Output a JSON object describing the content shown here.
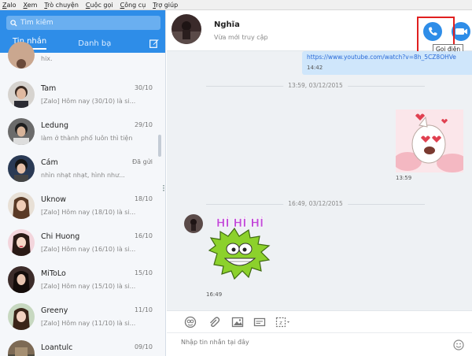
{
  "menu": [
    "Zalo",
    "Xem",
    "Trò chuyện",
    "Cuộc gọi",
    "Công cụ",
    "Trợ giúp"
  ],
  "menu_underline": [
    "Z",
    "X",
    "T",
    "C",
    "C",
    "T"
  ],
  "search": {
    "placeholder": "Tìm kiếm"
  },
  "tabs": {
    "messages": "Tin nhắn",
    "contacts": "Danh bạ"
  },
  "contacts": [
    {
      "name": "",
      "preview": "hix.",
      "date": ""
    },
    {
      "name": "Tam",
      "preview": "[Zalo] Hôm nay (30/10) là si...",
      "date": "30/10"
    },
    {
      "name": "Ledung",
      "preview": "làm ở thành phố luôn thì tiện",
      "date": "29/10"
    },
    {
      "name": "Cám",
      "preview": "nhìn nhạt nhạt, hình như...",
      "date": "Đã gửi"
    },
    {
      "name": "Uknow",
      "preview": "[Zalo] Hôm nay (18/10) là si...",
      "date": "18/10"
    },
    {
      "name": "Chi Huong",
      "preview": "[Zalo] Hôm nay (16/10) là si...",
      "date": "16/10"
    },
    {
      "name": "MiToLo",
      "preview": "[Zalo] Hôm nay (15/10) là si...",
      "date": "15/10"
    },
    {
      "name": "Greeny",
      "preview": "[Zalo] Hôm nay (11/10) là si...",
      "date": "11/10"
    },
    {
      "name": "Loantulc",
      "preview": "",
      "date": "09/10"
    }
  ],
  "chat": {
    "name": "Nghĩa",
    "status": "Vừa mới truy cập",
    "call_tooltip": "Gọi điện",
    "link_text": "https://www.youtube.com/watch?v=8h_5CZ8OHVe",
    "link_time": "14:42",
    "separator1": "13:59, 03/12/2015",
    "sticker1_time": "13:59",
    "separator2": "16:49, 03/12/2015",
    "sticker2_caption": "HÍ HÍ HÍ",
    "sticker2_time": "16:49",
    "input_placeholder": "Nhập tin nhắn tại đây"
  },
  "colors": {
    "accent": "#2e8de8",
    "highlight": "#e02020",
    "chat_bg": "#eef1f4",
    "bubble": "#cfe6fb"
  }
}
